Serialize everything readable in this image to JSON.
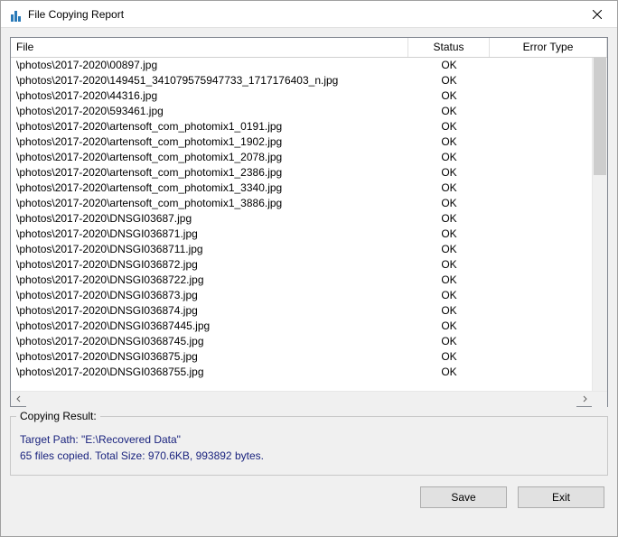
{
  "window": {
    "title": "File Copying Report"
  },
  "columns": {
    "file": "File",
    "status": "Status",
    "error": "Error Type"
  },
  "rows": [
    {
      "file": "\\photos\\2017-2020\\00897.jpg",
      "status": "OK",
      "error": ""
    },
    {
      "file": "\\photos\\2017-2020\\149451_341079575947733_1717176403_n.jpg",
      "status": "OK",
      "error": ""
    },
    {
      "file": "\\photos\\2017-2020\\44316.jpg",
      "status": "OK",
      "error": ""
    },
    {
      "file": "\\photos\\2017-2020\\593461.jpg",
      "status": "OK",
      "error": ""
    },
    {
      "file": "\\photos\\2017-2020\\artensoft_com_photomix1_0191.jpg",
      "status": "OK",
      "error": ""
    },
    {
      "file": "\\photos\\2017-2020\\artensoft_com_photomix1_1902.jpg",
      "status": "OK",
      "error": ""
    },
    {
      "file": "\\photos\\2017-2020\\artensoft_com_photomix1_2078.jpg",
      "status": "OK",
      "error": ""
    },
    {
      "file": "\\photos\\2017-2020\\artensoft_com_photomix1_2386.jpg",
      "status": "OK",
      "error": ""
    },
    {
      "file": "\\photos\\2017-2020\\artensoft_com_photomix1_3340.jpg",
      "status": "OK",
      "error": ""
    },
    {
      "file": "\\photos\\2017-2020\\artensoft_com_photomix1_3886.jpg",
      "status": "OK",
      "error": ""
    },
    {
      "file": "\\photos\\2017-2020\\DNSGI03687.jpg",
      "status": "OK",
      "error": ""
    },
    {
      "file": "\\photos\\2017-2020\\DNSGI036871.jpg",
      "status": "OK",
      "error": ""
    },
    {
      "file": "\\photos\\2017-2020\\DNSGI0368711.jpg",
      "status": "OK",
      "error": ""
    },
    {
      "file": "\\photos\\2017-2020\\DNSGI036872.jpg",
      "status": "OK",
      "error": ""
    },
    {
      "file": "\\photos\\2017-2020\\DNSGI0368722.jpg",
      "status": "OK",
      "error": ""
    },
    {
      "file": "\\photos\\2017-2020\\DNSGI036873.jpg",
      "status": "OK",
      "error": ""
    },
    {
      "file": "\\photos\\2017-2020\\DNSGI036874.jpg",
      "status": "OK",
      "error": ""
    },
    {
      "file": "\\photos\\2017-2020\\DNSGI03687445.jpg",
      "status": "OK",
      "error": ""
    },
    {
      "file": "\\photos\\2017-2020\\DNSGI0368745.jpg",
      "status": "OK",
      "error": ""
    },
    {
      "file": "\\photos\\2017-2020\\DNSGI036875.jpg",
      "status": "OK",
      "error": ""
    },
    {
      "file": "\\photos\\2017-2020\\DNSGI0368755.jpg",
      "status": "OK",
      "error": ""
    }
  ],
  "result": {
    "legend": "Copying Result:",
    "target": "Target Path: \"E:\\Recovered Data\"",
    "summary": "65 files copied. Total Size: 970.6KB, 993892 bytes."
  },
  "buttons": {
    "save": "Save",
    "exit": "Exit"
  }
}
